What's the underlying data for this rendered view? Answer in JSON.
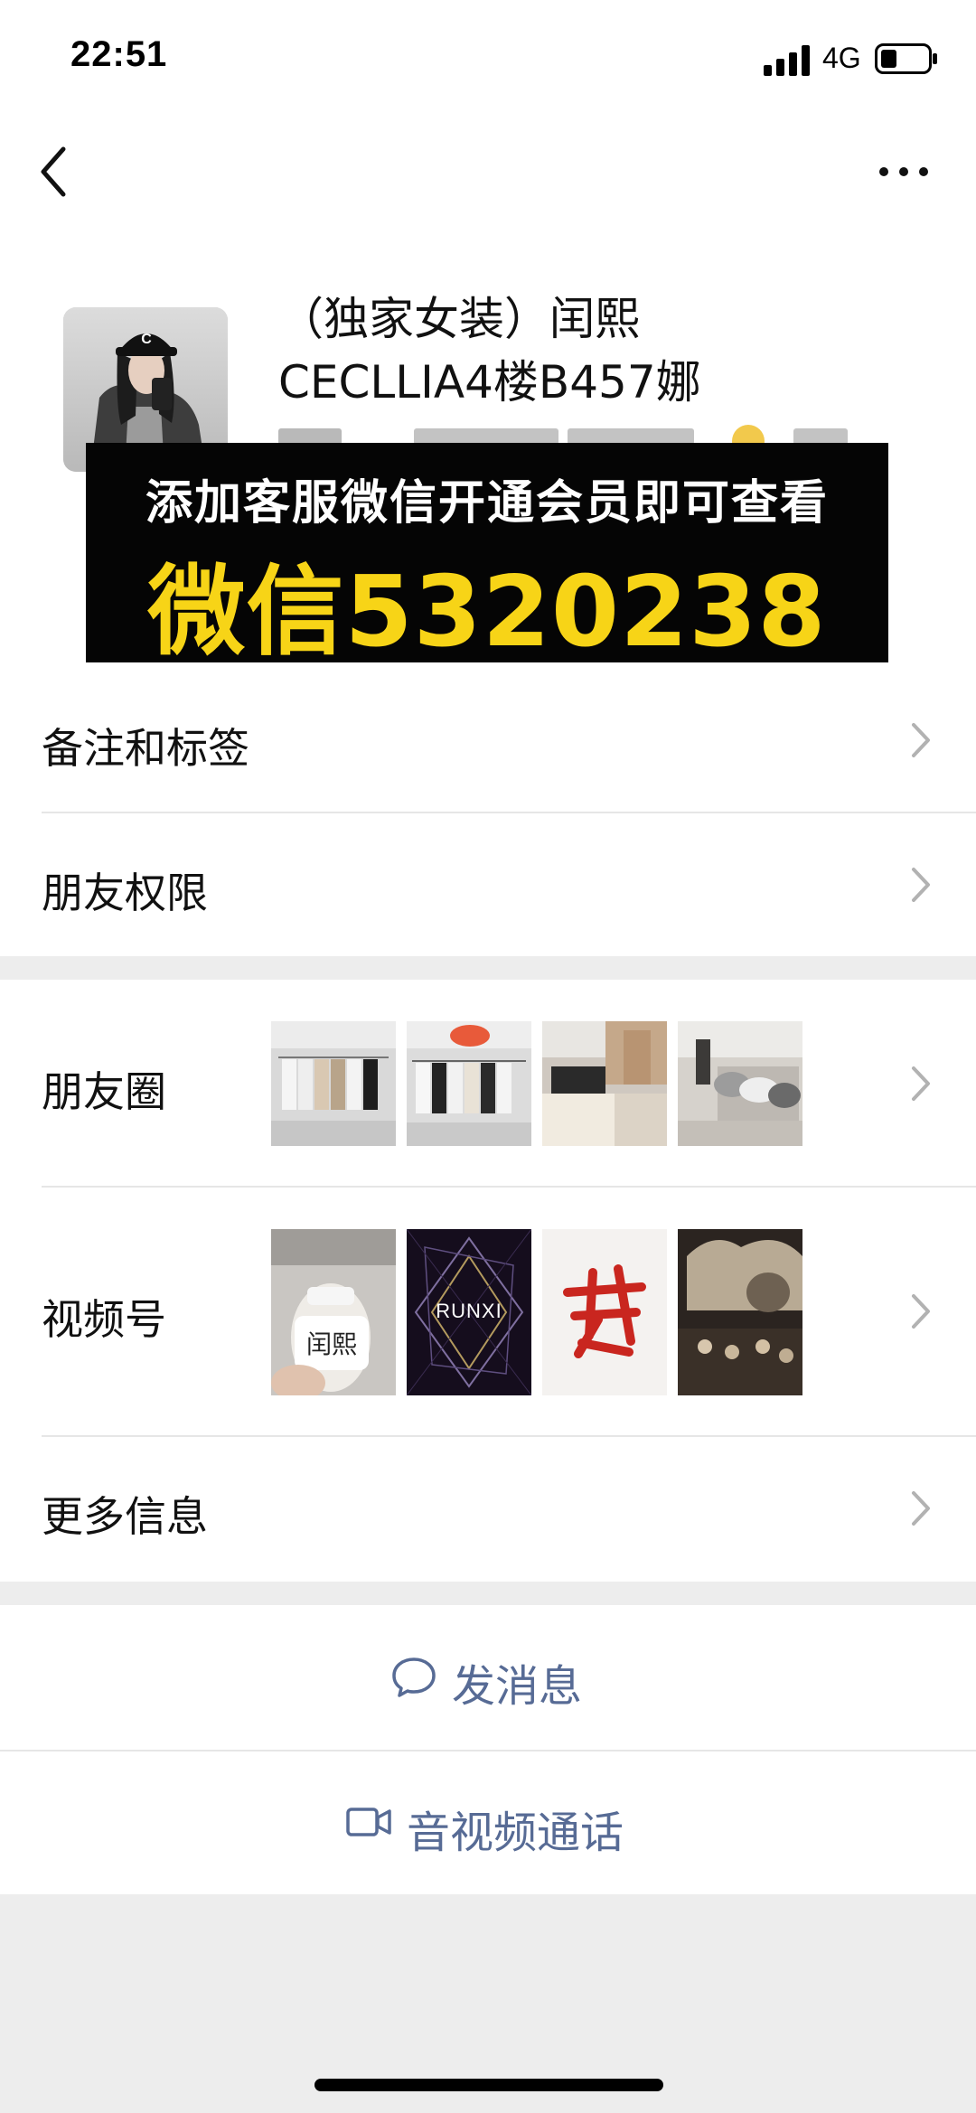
{
  "status_bar": {
    "time": "22:51",
    "network": "4G"
  },
  "header": {
    "back_icon": "chevron-left-icon",
    "more_icon": "ellipsis-icon"
  },
  "profile": {
    "name_line_1": "（独家女装）闰熙",
    "name_line_2": "CECLLIA4楼B457娜"
  },
  "promo_banner": {
    "line_1": "添加客服微信开通会员即可查看",
    "line_2": "微信5320238",
    "text_color": "#ffffff",
    "highlight_color": "#f7d417"
  },
  "menu": {
    "remarks_tags": "备注和标签",
    "friend_permissions": "朋友权限",
    "moments": "朋友圈",
    "channels": "视频号",
    "more_info": "更多信息"
  },
  "channels_thumbs": {
    "thumb_1_text": "闰熙",
    "thumb_2_text": "RUNXI"
  },
  "actions": {
    "send_message": "发消息",
    "video_call": "音视频通话",
    "link_color": "#576b95"
  }
}
